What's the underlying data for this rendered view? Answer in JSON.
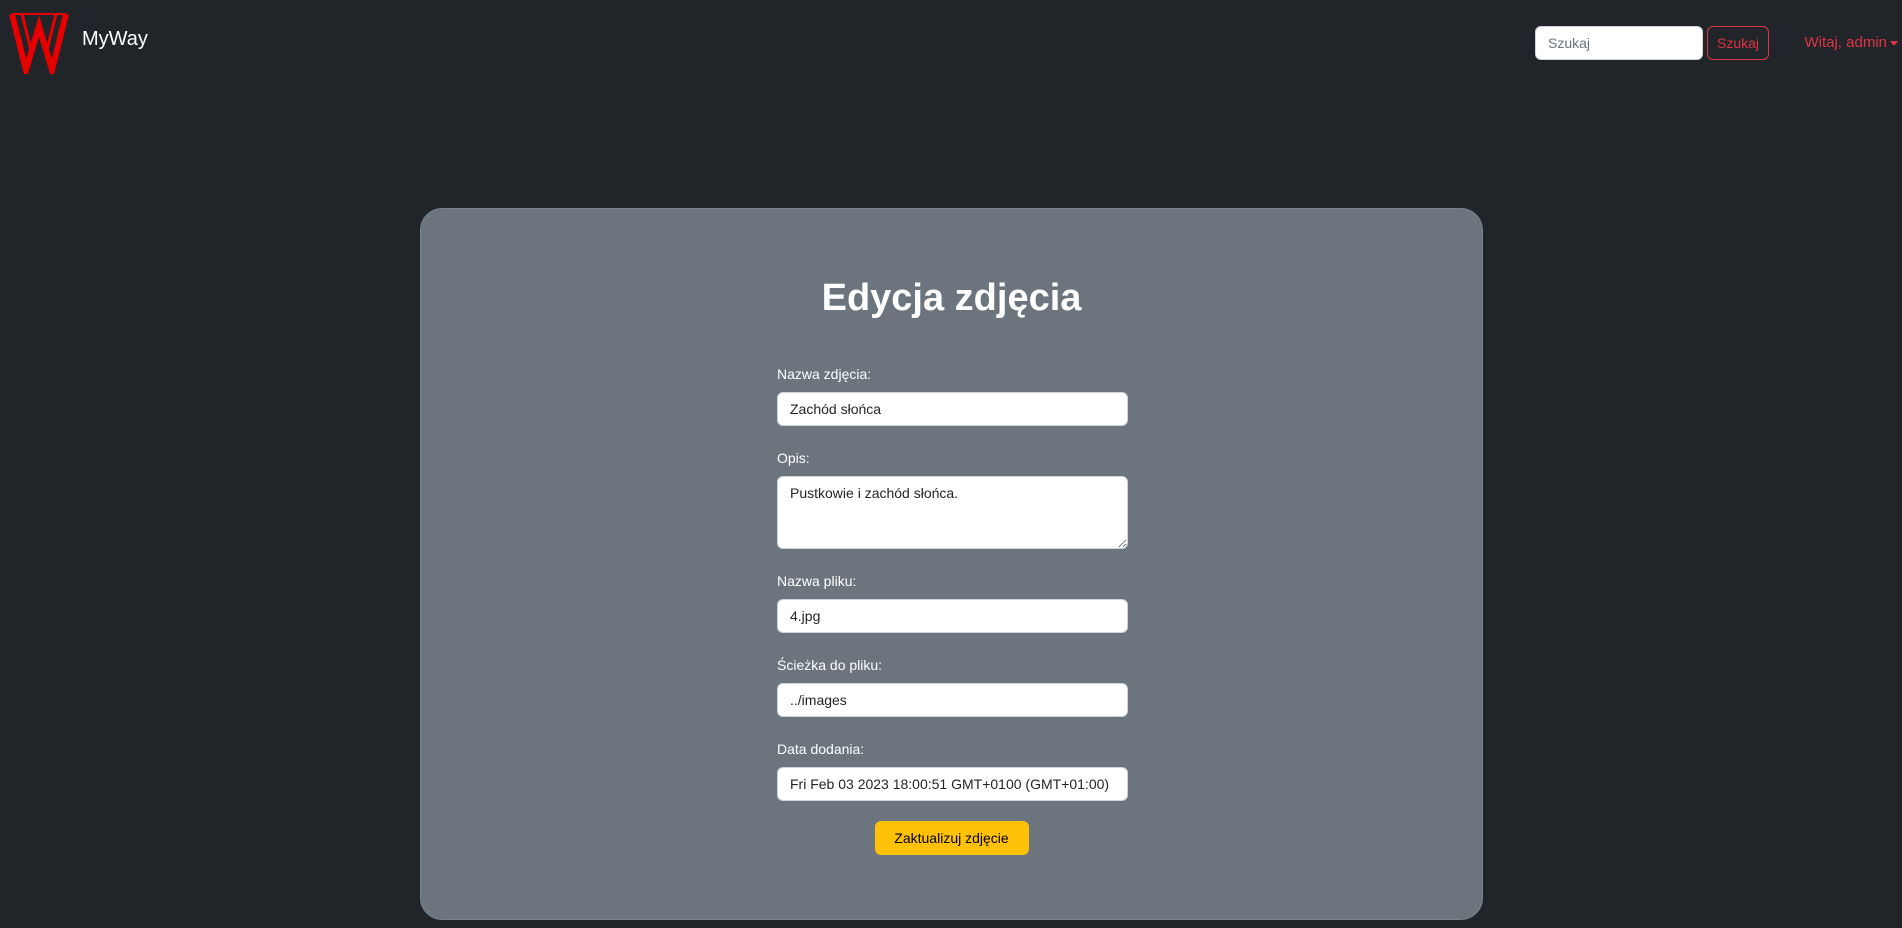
{
  "navbar": {
    "brand_name": "MyWay",
    "logo_icon": "myway-logo-icon",
    "search_placeholder": "Szukaj",
    "search_button_label": "Szukaj",
    "user_menu_label": "Witaj, admin",
    "user_menu_icon": "caret-down-icon"
  },
  "form": {
    "title": "Edycja zdjęcia",
    "fields": [
      {
        "label": "Nazwa zdjęcia:",
        "value": "Zachód słońca"
      },
      {
        "label": "Opis:",
        "value": "Pustkowie i zachód słońca."
      },
      {
        "label": "Nazwa pliku:",
        "value": "4.jpg"
      },
      {
        "label": "Ścieżka do pliku:",
        "value": "../images"
      },
      {
        "label": "Data dodania:",
        "value": "Fri Feb 03 2023 18:00:51 GMT+0100 (GMT+01:00)"
      }
    ],
    "submit_label": "Zaktualizuj zdjęcie"
  },
  "colors": {
    "page_background": "#212529",
    "card_background": "#6c757d",
    "accent_red": "#dc3545",
    "submit_yellow": "#ffc107"
  }
}
